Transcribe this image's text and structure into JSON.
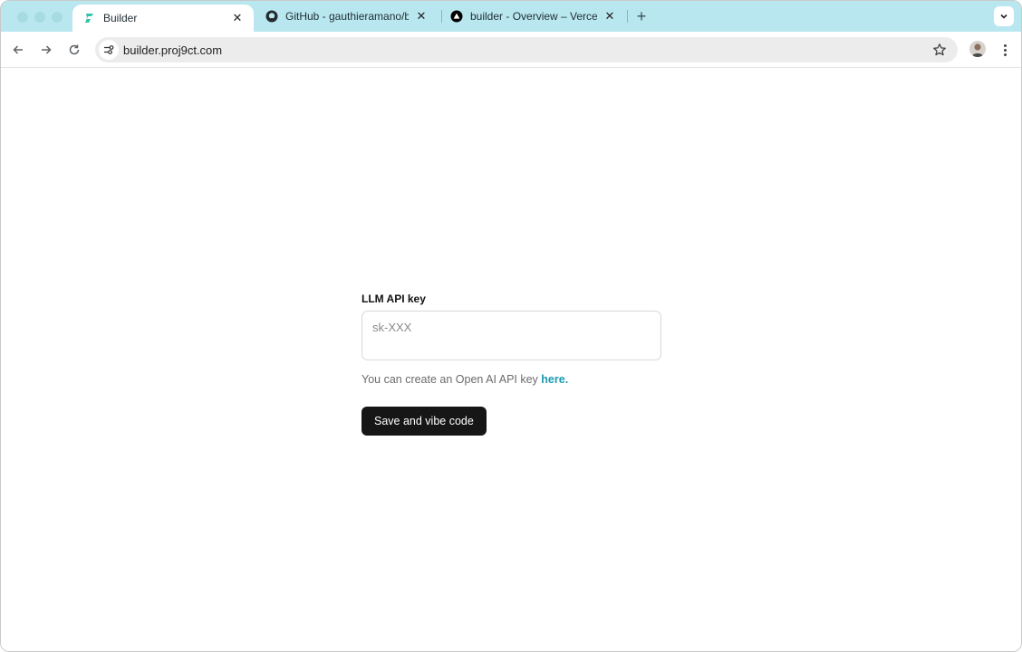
{
  "browser": {
    "tabs": [
      {
        "title": "Builder",
        "favicon": "builder-logo-icon",
        "active": true
      },
      {
        "title": "GitHub - gauthieramano/build",
        "favicon": "github-icon",
        "active": false
      },
      {
        "title": "builder - Overview – Vercel",
        "favicon": "vercel-icon",
        "active": false
      }
    ],
    "close_glyph": "✕",
    "new_tab_glyph": "+",
    "url": "builder.proj9ct.com",
    "accent_color": "#b9e7ef"
  },
  "form": {
    "label": "LLM API key",
    "input_value": "",
    "input_placeholder": "sk-XXX",
    "hint_text": "You can create an Open AI API key ",
    "hint_link": "here.",
    "submit_label": "Save and vibe code",
    "link_color": "#1a9bb0"
  }
}
